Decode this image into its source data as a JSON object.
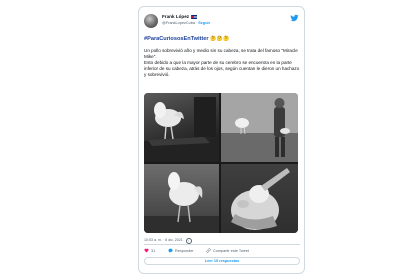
{
  "author": {
    "name": "Frank López",
    "handle": "@FrankLopezCuba",
    "follow_label": "Seguir"
  },
  "tweet": {
    "hashtag": "#ParaCuriososEnTwitter",
    "hashtag_emojis": "🤔🤔🤔",
    "paragraph1": "Un pollo sobrevivió año y medio sin su cabeza, se trata del famoso \"Miracle Mike\".",
    "paragraph2": "Esto debido a que la mayor parte de su cerebro se encuentra en la parte inferior de su cabeza, atrás de los ojos, según cuentan le dieron un hachazo y sobrevivió.",
    "timestamp": "10:53 a. m. · 8 dic. 2021"
  },
  "actions": {
    "like_count": "31",
    "reply_label": "Responder",
    "share_label": "Compartir este Tweet"
  },
  "replies_button": "Leer 15 respuestas",
  "icons": {
    "platform": "twitter-bird-icon",
    "like": "heart-icon",
    "reply": "speech-bubble-icon",
    "share": "link-icon",
    "info": "info-icon"
  },
  "colors": {
    "accent": "#1d9bf0",
    "like": "#f91880",
    "hashtag": "#1b3f9a",
    "muted": "#536471",
    "border": "#cfd9de"
  }
}
